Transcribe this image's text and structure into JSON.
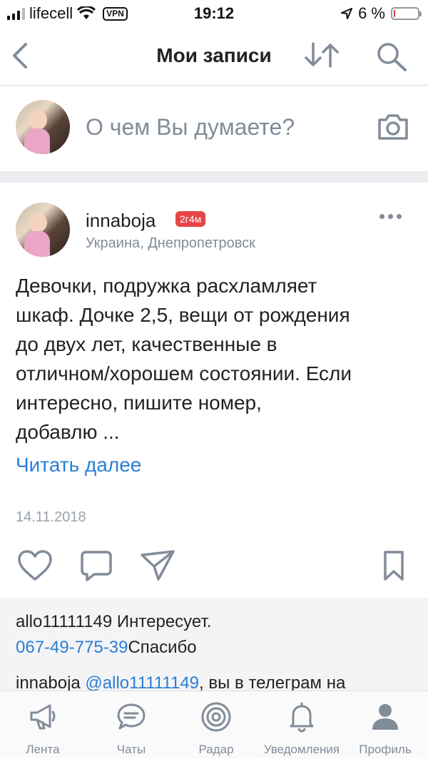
{
  "status": {
    "carrier": "lifecell",
    "vpn": "VPN",
    "time": "19:12",
    "battery": "6 %",
    "battery_level": 0.06
  },
  "nav": {
    "title": "Мои записи"
  },
  "composer": {
    "placeholder": "О чем Вы думаете?"
  },
  "post": {
    "author": "innaboja",
    "badge": "2г4м",
    "location": "Украина, Днепропетровск",
    "text_lines": [
      "Девочки, подружка расхламляет",
      "шкаф. Дочке 2,5, вещи от рождения",
      "до двух лет, качественные в",
      "отличном/хорошем состоянии. Если",
      "интересно, пишите номер,",
      "добавлю ..."
    ],
    "read_more": "Читать далее",
    "date": "14.11.2018"
  },
  "comments": [
    {
      "author": "allo11111149",
      "text": " Интересует.",
      "phone": "067-49-775-39",
      "after": "Спасибо"
    },
    {
      "author": "innaboja",
      "mention": "@allo11111149",
      "text": ", вы в телеграм на"
    }
  ],
  "tabs": [
    {
      "label": "Лента",
      "icon": "megaphone-icon"
    },
    {
      "label": "Чаты",
      "icon": "chat-icon"
    },
    {
      "label": "Радар",
      "icon": "radar-icon"
    },
    {
      "label": "Уведомления",
      "icon": "bell-icon"
    },
    {
      "label": "Профиль",
      "icon": "person-icon"
    }
  ],
  "colors": {
    "accent": "#2a7ed6",
    "badge": "#e64646",
    "muted": "#818c99"
  }
}
